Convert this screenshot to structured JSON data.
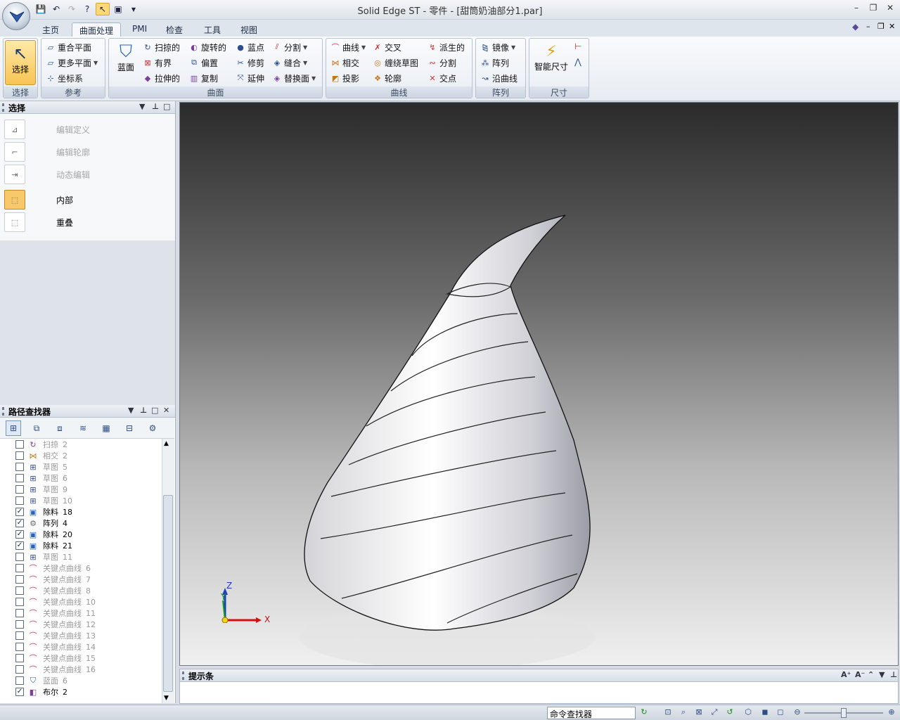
{
  "window": {
    "title": "Solid Edge ST - 零件 - [甜筒奶油部分1.par]",
    "controls": [
      "–",
      "❐",
      "✕"
    ],
    "doc_controls": [
      "–",
      "❐",
      "✕"
    ]
  },
  "tabs": [
    "主页",
    "曲面处理",
    "PMI",
    "检查",
    "工具",
    "视图"
  ],
  "ribbon": {
    "select": {
      "label": "选择",
      "group": "选择"
    },
    "reference": {
      "group": "参考",
      "items": [
        "重合平面",
        "更多平面",
        "坐标系"
      ]
    },
    "surface": {
      "group": "曲面",
      "big": "蓝面",
      "items": [
        "扫掠的",
        "有界",
        "拉伸的",
        "旋转的",
        "偏置",
        "复制",
        "蓝点",
        "修剪",
        "延伸",
        "分割",
        "缝合",
        "替换面"
      ]
    },
    "curve": {
      "group": "曲线",
      "items": [
        "曲线",
        "相交",
        "投影",
        "交叉",
        "缠绕草图",
        "轮廓",
        "派生的",
        "分割",
        "交点"
      ]
    },
    "pattern": {
      "group": "阵列",
      "items": [
        "镜像",
        "阵列",
        "沿曲线"
      ]
    },
    "dim": {
      "group": "尺寸",
      "big": "智能尺寸"
    }
  },
  "select_panel": {
    "title": "选择",
    "items": [
      {
        "label": "编辑定义",
        "enabled": false
      },
      {
        "label": "编辑轮廓",
        "enabled": false
      },
      {
        "label": "动态编辑",
        "enabled": false
      },
      {
        "label": "内部",
        "enabled": true
      },
      {
        "label": "重叠",
        "enabled": true
      }
    ]
  },
  "pathfinder": {
    "title": "路径查找器",
    "items": [
      {
        "label": "扫掠",
        "n": "2",
        "checked": false,
        "icon": "sweep-icon"
      },
      {
        "label": "相交",
        "n": "2",
        "checked": false,
        "icon": "intersect-icon"
      },
      {
        "label": "草图",
        "n": "5",
        "checked": false,
        "icon": "sketch-icon"
      },
      {
        "label": "草图",
        "n": "6",
        "checked": false,
        "icon": "sketch-icon"
      },
      {
        "label": "草图",
        "n": "9",
        "checked": false,
        "icon": "sketch-icon"
      },
      {
        "label": "草图",
        "n": "10",
        "checked": false,
        "icon": "sketch-icon"
      },
      {
        "label": "除料",
        "n": "18",
        "checked": true,
        "icon": "cutout-icon"
      },
      {
        "label": "阵列",
        "n": "4",
        "checked": true,
        "icon": "pattern-icon"
      },
      {
        "label": "除料",
        "n": "20",
        "checked": true,
        "icon": "cutout-icon"
      },
      {
        "label": "除料",
        "n": "21",
        "checked": true,
        "icon": "cutout-icon"
      },
      {
        "label": "草图",
        "n": "11",
        "checked": false,
        "icon": "sketch-icon"
      },
      {
        "label": "关键点曲线",
        "n": "6",
        "checked": false,
        "icon": "curve-icon"
      },
      {
        "label": "关键点曲线",
        "n": "7",
        "checked": false,
        "icon": "curve-icon"
      },
      {
        "label": "关键点曲线",
        "n": "8",
        "checked": false,
        "icon": "curve-icon"
      },
      {
        "label": "关键点曲线",
        "n": "10",
        "checked": false,
        "icon": "curve-icon"
      },
      {
        "label": "关键点曲线",
        "n": "11",
        "checked": false,
        "icon": "curve-icon"
      },
      {
        "label": "关键点曲线",
        "n": "12",
        "checked": false,
        "icon": "curve-icon"
      },
      {
        "label": "关键点曲线",
        "n": "13",
        "checked": false,
        "icon": "curve-icon"
      },
      {
        "label": "关键点曲线",
        "n": "14",
        "checked": false,
        "icon": "curve-icon"
      },
      {
        "label": "关键点曲线",
        "n": "15",
        "checked": false,
        "icon": "curve-icon"
      },
      {
        "label": "关键点曲线",
        "n": "16",
        "checked": false,
        "icon": "curve-icon"
      },
      {
        "label": "蓝面",
        "n": "6",
        "checked": false,
        "icon": "bluesurf-icon"
      },
      {
        "label": "布尔",
        "n": "2",
        "checked": true,
        "icon": "boolean-icon"
      }
    ]
  },
  "viewport": {
    "axes": {
      "x": "X",
      "y": "Y",
      "z": "Z"
    }
  },
  "prompt_bar": {
    "title": "提示条"
  },
  "status": {
    "command_finder": "命令查找器"
  }
}
